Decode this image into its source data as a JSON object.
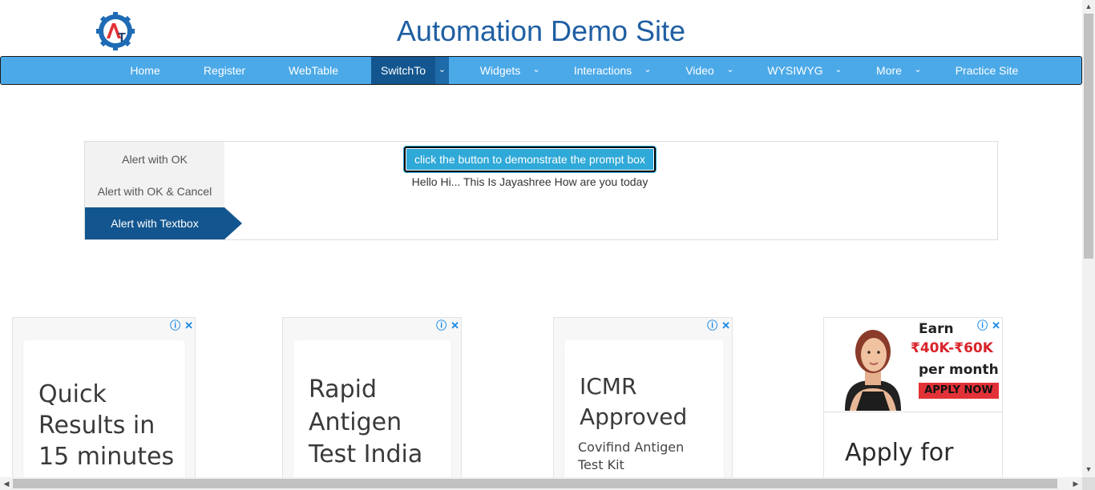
{
  "header": {
    "title": "Automation Demo Site",
    "logo_letters": "AT"
  },
  "nav": {
    "items": [
      {
        "label": "Home"
      },
      {
        "label": "Register"
      },
      {
        "label": "WebTable"
      },
      {
        "label": "SwitchTo",
        "active": true
      },
      {
        "label": "Widgets"
      },
      {
        "label": "Interactions"
      },
      {
        "label": "Video"
      },
      {
        "label": "WYSIWYG"
      },
      {
        "label": "More"
      },
      {
        "label": "Practice Site"
      }
    ],
    "caret_glyph": "⌄"
  },
  "alerts": {
    "tabs": [
      {
        "label": "Alert with OK"
      },
      {
        "label": "Alert with OK & Cancel"
      },
      {
        "label": "Alert with Textbox",
        "active": true
      }
    ],
    "button_label": "click the button to demonstrate the prompt box",
    "result_text": "Hello Hi... This Is Jayashree How are you today"
  },
  "ads": [
    {
      "headline": [
        "Quick",
        "Results in",
        "15 minutes"
      ]
    },
    {
      "headline": [
        "Rapid",
        "Antigen",
        "Test India"
      ]
    },
    {
      "headline": [
        "ICMR",
        "Approved"
      ],
      "sub": [
        "Covifind Antigen",
        "Test Kit"
      ]
    },
    {
      "banner": {
        "earn": "Earn",
        "amount": "₹40K-₹60K",
        "per_month": "per month",
        "cta": "APPLY NOW"
      },
      "headline": "Apply for"
    }
  ],
  "ad_controls": {
    "info": "ⓘ",
    "close": "✕"
  },
  "colors": {
    "title": "#1f5fa3",
    "navbar": "#4ba9e8",
    "nav_active": "#13568f",
    "button": "#2fa9d8",
    "ad_link": "#1a8ae8"
  },
  "icons": [
    "logo-gear-icon",
    "chevron-down-icon",
    "info-icon",
    "close-icon",
    "scroll-arrow-icon"
  ]
}
